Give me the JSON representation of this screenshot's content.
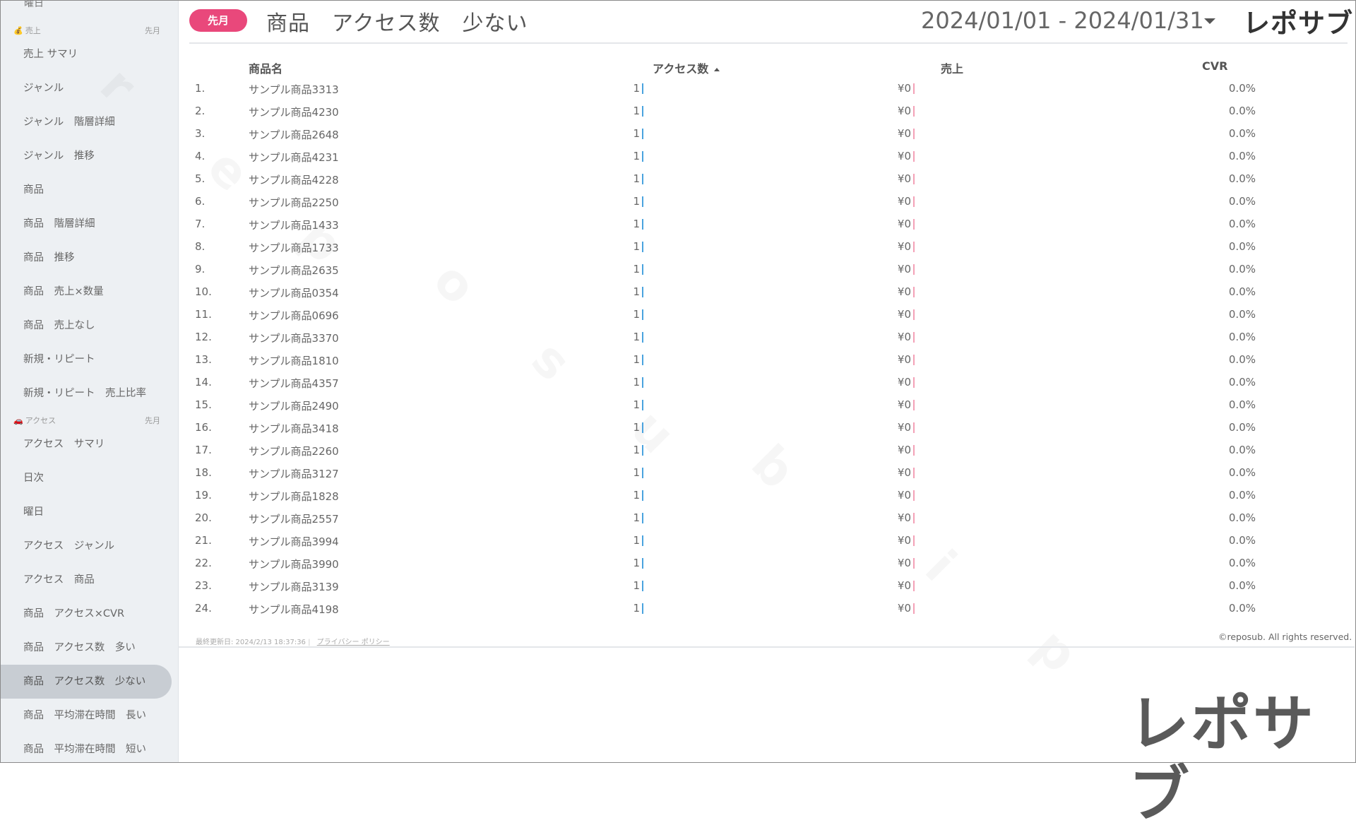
{
  "sidebar": {
    "top_cut_label": "曜日",
    "sections": [
      {
        "emoji": "💰",
        "title": "売上",
        "right": "先月"
      },
      {
        "emoji": "🚗",
        "title": "アクセス",
        "right": "先月"
      }
    ],
    "sales_items": [
      "売上 サマリ",
      "ジャンル",
      "ジャンル　階層詳細",
      "ジャンル　推移",
      "商品",
      "商品　階層詳細",
      "商品　推移",
      "商品　売上×数量",
      "商品　売上なし",
      "新規・リピート",
      "新規・リピート　売上比率"
    ],
    "access_items": [
      "アクセス　サマリ",
      "日次",
      "曜日",
      "アクセス　ジャンル",
      "アクセス　商品",
      "商品　アクセス×CVR",
      "商品　アクセス数　多い",
      "商品　アクセス数　少ない",
      "商品　平均滞在時間　長い",
      "商品　平均滞在時間　短い"
    ],
    "active_item": "商品　アクセス数　少ない"
  },
  "header": {
    "period_pill": "先月",
    "title": "商品　アクセス数　少ない",
    "date_range": "2024/01/01 - 2024/01/31",
    "brand": "レポサブ"
  },
  "table": {
    "columns": {
      "name": "商品名",
      "access": "アクセス数",
      "sales": "売上",
      "cvr": "CVR"
    },
    "rows": [
      {
        "rank": "1.",
        "name": "サンプル商品3313",
        "access": "1",
        "sales": "¥0",
        "cvr": "0.0%"
      },
      {
        "rank": "2.",
        "name": "サンプル商品4230",
        "access": "1",
        "sales": "¥0",
        "cvr": "0.0%"
      },
      {
        "rank": "3.",
        "name": "サンプル商品2648",
        "access": "1",
        "sales": "¥0",
        "cvr": "0.0%"
      },
      {
        "rank": "4.",
        "name": "サンプル商品4231",
        "access": "1",
        "sales": "¥0",
        "cvr": "0.0%"
      },
      {
        "rank": "5.",
        "name": "サンプル商品4228",
        "access": "1",
        "sales": "¥0",
        "cvr": "0.0%"
      },
      {
        "rank": "6.",
        "name": "サンプル商品2250",
        "access": "1",
        "sales": "¥0",
        "cvr": "0.0%"
      },
      {
        "rank": "7.",
        "name": "サンプル商品1433",
        "access": "1",
        "sales": "¥0",
        "cvr": "0.0%"
      },
      {
        "rank": "8.",
        "name": "サンプル商品1733",
        "access": "1",
        "sales": "¥0",
        "cvr": "0.0%"
      },
      {
        "rank": "9.",
        "name": "サンプル商品2635",
        "access": "1",
        "sales": "¥0",
        "cvr": "0.0%"
      },
      {
        "rank": "10.",
        "name": "サンプル商品0354",
        "access": "1",
        "sales": "¥0",
        "cvr": "0.0%"
      },
      {
        "rank": "11.",
        "name": "サンプル商品0696",
        "access": "1",
        "sales": "¥0",
        "cvr": "0.0%"
      },
      {
        "rank": "12.",
        "name": "サンプル商品3370",
        "access": "1",
        "sales": "¥0",
        "cvr": "0.0%"
      },
      {
        "rank": "13.",
        "name": "サンプル商品1810",
        "access": "1",
        "sales": "¥0",
        "cvr": "0.0%"
      },
      {
        "rank": "14.",
        "name": "サンプル商品4357",
        "access": "1",
        "sales": "¥0",
        "cvr": "0.0%"
      },
      {
        "rank": "15.",
        "name": "サンプル商品2490",
        "access": "1",
        "sales": "¥0",
        "cvr": "0.0%"
      },
      {
        "rank": "16.",
        "name": "サンプル商品3418",
        "access": "1",
        "sales": "¥0",
        "cvr": "0.0%"
      },
      {
        "rank": "17.",
        "name": "サンプル商品2260",
        "access": "1",
        "sales": "¥0",
        "cvr": "0.0%"
      },
      {
        "rank": "18.",
        "name": "サンプル商品3127",
        "access": "1",
        "sales": "¥0",
        "cvr": "0.0%"
      },
      {
        "rank": "19.",
        "name": "サンプル商品1828",
        "access": "1",
        "sales": "¥0",
        "cvr": "0.0%"
      },
      {
        "rank": "20.",
        "name": "サンプル商品2557",
        "access": "1",
        "sales": "¥0",
        "cvr": "0.0%"
      },
      {
        "rank": "21.",
        "name": "サンプル商品3994",
        "access": "1",
        "sales": "¥0",
        "cvr": "0.0%"
      },
      {
        "rank": "22.",
        "name": "サンプル商品3990",
        "access": "1",
        "sales": "¥0",
        "cvr": "0.0%"
      },
      {
        "rank": "23.",
        "name": "サンプル商品3139",
        "access": "1",
        "sales": "¥0",
        "cvr": "0.0%"
      },
      {
        "rank": "24.",
        "name": "サンプル商品4198",
        "access": "1",
        "sales": "¥0",
        "cvr": "0.0%"
      }
    ]
  },
  "footer": {
    "updated": "最終更新日: 2024/2/13 18:37:36",
    "privacy": "プライバシー ポリシー",
    "copyright": "©reposub. All rights reserved."
  },
  "watermark": [
    "r",
    "e",
    "p",
    "o",
    "s",
    "u",
    "b",
    "i",
    "p"
  ],
  "brand_large": "レポサブ",
  "colors": {
    "accent": "#e9487b",
    "sidebar_bg": "#edf0f3",
    "active_bg": "#c8cdd3",
    "bar_blue": "#4aa3df",
    "bar_pink": "#f3a1b7"
  }
}
